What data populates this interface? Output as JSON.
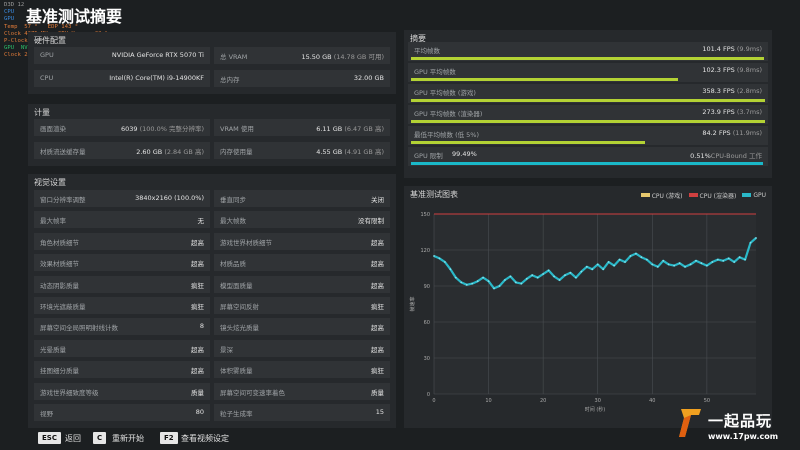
{
  "overlay": {
    "lines": [
      {
        "text": "D3D 12",
        "color": "#9a9a9a"
      },
      {
        "text": "CPU",
        "color": "#3a8ae0"
      },
      {
        "text": "GPU",
        "color": "#3a8ae0"
      },
      {
        "text": "Temp  57 °   EDP 143 °",
        "color": "#e07b39"
      },
      {
        "text": "Clock 4275 MHz  CPU Usage  22 %",
        "color": "#e07b39"
      },
      {
        "text": "P-Clock 5499 MHz",
        "color": "#e07b39"
      },
      {
        "text": "GPU  NVIDIA GeForce RTX 5070 Ti",
        "color": "#2bbf6a"
      },
      {
        "text": "Clock 2925 MHz  Temp 59 °  EDP 279 °",
        "color": "#e07b39"
      }
    ]
  },
  "page_title": "基准测试摘要",
  "hardware": {
    "title": "硬件配置",
    "rows": [
      {
        "l1": "GPU",
        "v1": "NVIDIA GeForce RTX 5070 Ti",
        "l2": "总 VRAM",
        "v2": "15.50 GB",
        "s2": "(14.78 GB 可用)"
      },
      {
        "l1": "CPU",
        "v1": "Intel(R) Core(TM) i9-14900KF",
        "l2": "总内存",
        "v2": "32.00 GB",
        "s2": ""
      }
    ]
  },
  "compute": {
    "title": "计量",
    "rows": [
      {
        "l1": "画面渲染",
        "v1": "6039",
        "s1": "(100.0% 完整分辨率)",
        "l2": "VRAM 使用",
        "v2": "6.11 GB",
        "s2": "(6.47 GB 高)"
      },
      {
        "l1": "材质流送缓存量",
        "v1": "2.60 GB",
        "s1": "(2.84 GB 高)",
        "l2": "内存使用量",
        "v2": "4.55 GB",
        "s2": "(4.91 GB 高)"
      }
    ]
  },
  "video": {
    "title": "视觉设置",
    "rows": [
      {
        "l1": "窗口分辨率调整",
        "v1": "3840x2160 (100.0%)",
        "l2": "垂直同步",
        "v2": "关闭"
      },
      {
        "l1": "最大帧率",
        "v1": "无",
        "l2": "最大帧数",
        "v2": "没有限制"
      },
      {
        "l1": "角色材质细节",
        "v1": "超高",
        "l2": "游戏世界材质细节",
        "v2": "超高"
      },
      {
        "l1": "效果材质细节",
        "v1": "超高",
        "l2": "材质品质",
        "v2": "超高"
      },
      {
        "l1": "动态阴影质量",
        "v1": "疯狂",
        "l2": "模型面质量",
        "v2": "超高"
      },
      {
        "l1": "环境光遮蔽质量",
        "v1": "疯狂",
        "l2": "屏幕空间反射",
        "v2": "疯狂"
      },
      {
        "l1": "屏幕空间全局照明射线计数",
        "v1": "8",
        "l2": "镜头炫光质量",
        "v2": "超高"
      },
      {
        "l1": "光晕质量",
        "v1": "超高",
        "l2": "景深",
        "v2": "超高"
      },
      {
        "l1": "挂图细分质量",
        "v1": "超高",
        "l2": "体积雾质量",
        "v2": "疯狂"
      },
      {
        "l1": "游戏世界细致度等级",
        "v1": "质量",
        "l2": "屏幕空间可变速率着色",
        "v2": "质量"
      },
      {
        "l1": "视野",
        "v1": "80",
        "l2": "粒子生成率",
        "v2": "15"
      }
    ]
  },
  "summary": {
    "title": "摘要",
    "rows": [
      {
        "label": "平均帧数",
        "value": "101.4 FPS",
        "sub": "(9.9ms)",
        "frac": 0.998,
        "color": "#b3d234"
      },
      {
        "label": "GPU 平均帧数",
        "value": "102.3 FPS",
        "sub": "(9.8ms)",
        "frac": 0.755,
        "color": "#b3d234"
      },
      {
        "label": "GPU 平均帧数 (游戏)",
        "value": "358.3 FPS",
        "sub": "(2.8ms)",
        "frac": 1.0,
        "color": "#b3d234"
      },
      {
        "label": "GPU 平均帧数 (渲染器)",
        "value": "273.9 FPS",
        "sub": "(3.7ms)",
        "frac": 1.0,
        "color": "#b3d234"
      },
      {
        "label": "最低平均帧数 (低 5%)",
        "value": "84.2 FPS",
        "sub": "(11.9ms)",
        "frac": 0.66,
        "color": "#b3d234"
      }
    ],
    "gpu_bound": {
      "label": "GPU 限制",
      "pct": "99.49%",
      "right_pct": "0.51%",
      "right_label": "CPU-Bound 工作",
      "frac": 0.995,
      "color": "#1ab8c8"
    }
  },
  "chart": {
    "title": "基准测试图表",
    "legend": [
      {
        "name": "CPU (游戏)",
        "color": "#e6c86e"
      },
      {
        "name": "CPU (渲染器)",
        "color": "#d04040"
      },
      {
        "name": "GPU",
        "color": "#2ab8c8"
      }
    ]
  },
  "chart_data": {
    "type": "line",
    "title": "基准测试图表",
    "xlabel": "时间 (秒)",
    "ylabel": "帧速率",
    "xlim": [
      0,
      59
    ],
    "ylim": [
      0,
      150
    ],
    "xticks": [
      0,
      10,
      20,
      30,
      40,
      50
    ],
    "yticks": [
      0,
      30,
      60,
      90,
      120,
      150
    ],
    "grid": true,
    "legend_position": "top-right",
    "series": [
      {
        "name": "GPU",
        "color": "#2ab8c8",
        "x": [
          0,
          1,
          2,
          3,
          4,
          5,
          6,
          7,
          8,
          9,
          10,
          11,
          12,
          13,
          14,
          15,
          16,
          17,
          18,
          19,
          20,
          21,
          22,
          23,
          24,
          25,
          26,
          27,
          28,
          29,
          30,
          31,
          32,
          33,
          34,
          35,
          36,
          37,
          38,
          39,
          40,
          41,
          42,
          43,
          44,
          45,
          46,
          47,
          48,
          49,
          50,
          51,
          52,
          53,
          54,
          55,
          56,
          57,
          58,
          59
        ],
        "y": [
          115,
          113,
          110,
          104,
          97,
          93,
          91,
          92,
          94,
          97,
          94,
          88,
          90,
          95,
          98,
          93,
          92,
          96,
          99,
          97,
          100,
          103,
          98,
          95,
          99,
          101,
          97,
          102,
          106,
          104,
          108,
          104,
          110,
          107,
          112,
          110,
          115,
          117,
          114,
          112,
          108,
          106,
          111,
          108,
          107,
          109,
          106,
          108,
          111,
          109,
          107,
          110,
          112,
          111,
          113,
          110,
          114,
          112,
          126,
          130
        ]
      },
      {
        "name": "CPU (渲染器)",
        "color": "#d04040",
        "x": [
          0,
          59
        ],
        "y": [
          150,
          150
        ]
      }
    ]
  },
  "bottom": {
    "esc_key": "ESC",
    "esc_label": "返回",
    "c_key": "C",
    "c_label": "重新开始",
    "f2_key": "F2",
    "f2_label": "查看视频设定"
  },
  "watermark": {
    "brand": "一起品玩",
    "url": "www.17pw.com"
  }
}
